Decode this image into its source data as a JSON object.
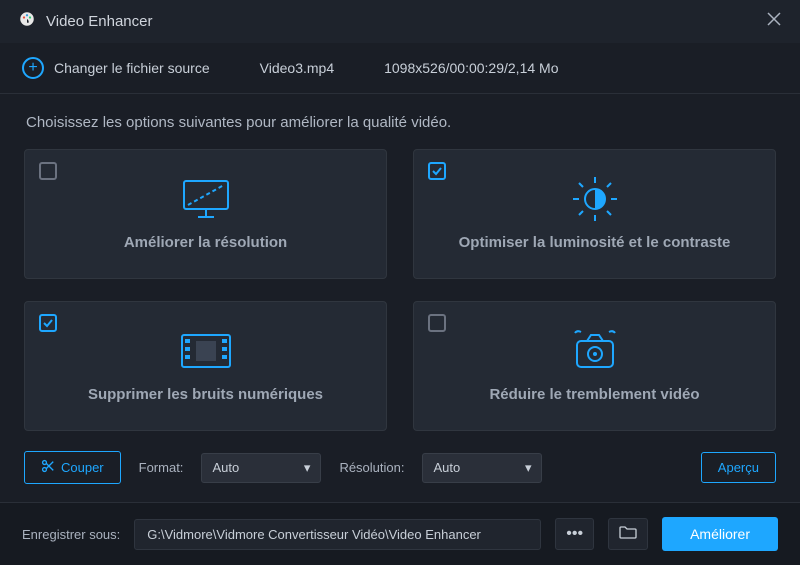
{
  "titlebar": {
    "app_title": "Video Enhancer"
  },
  "source": {
    "change_label": "Changer le fichier source",
    "filename": "Video3.mp4",
    "meta": "1098x526/00:00:29/2,14 Mo"
  },
  "instruction": "Choisissez les options suivantes pour améliorer la qualité vidéo.",
  "cards": {
    "resolution": {
      "label": "Améliorer la résolution",
      "checked": false
    },
    "brightness": {
      "label": "Optimiser la luminosité et le contraste",
      "checked": true
    },
    "noise": {
      "label": "Supprimer les bruits numériques",
      "checked": true
    },
    "shake": {
      "label": "Réduire le tremblement vidéo",
      "checked": false
    }
  },
  "controls": {
    "cut_label": "Couper",
    "format_label": "Format:",
    "format_value": "Auto",
    "resolution_label": "Résolution:",
    "resolution_value": "Auto",
    "preview_label": "Aperçu"
  },
  "footer": {
    "save_label": "Enregistrer sous:",
    "path": "G:\\Vidmore\\Vidmore Convertisseur Vidéo\\Video Enhancer",
    "enhance_label": "Améliorer"
  }
}
